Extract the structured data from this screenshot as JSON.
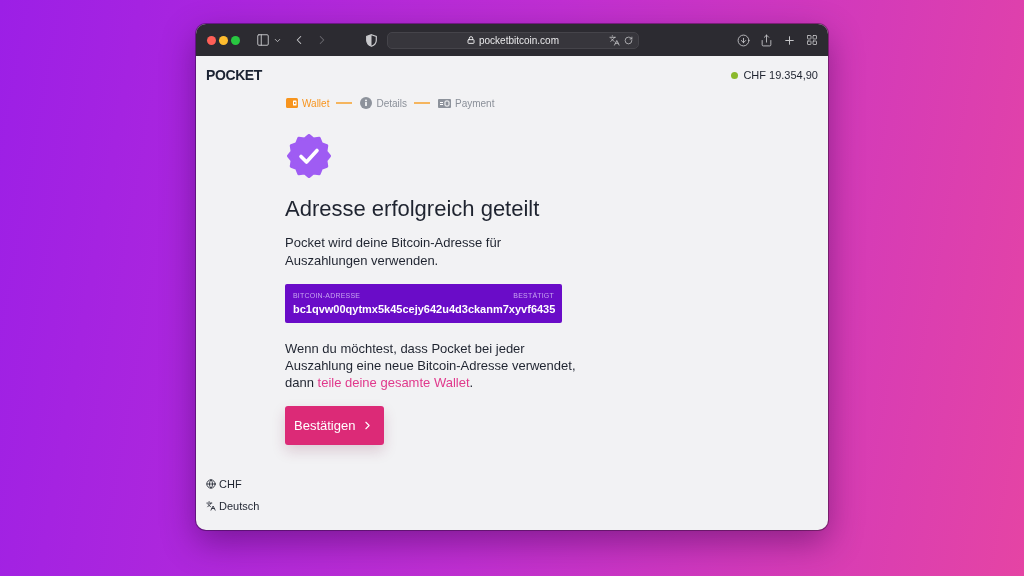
{
  "browser": {
    "url": "pocketbitcoin.com",
    "forward_disabled": true
  },
  "header": {
    "logo": "POCKET",
    "balance": "CHF 19.354,90"
  },
  "steps": [
    {
      "kind": "wallet",
      "label": "Wallet",
      "selected": true
    },
    {
      "kind": "info",
      "label": "Details",
      "selected": false
    },
    {
      "kind": "payment",
      "label": "Payment",
      "selected": false
    }
  ],
  "title": "Adresse erfolgreich geteilt",
  "intro": "Pocket wird deine Bitcoin-Adresse für Auszahlungen verwenden.",
  "address_card": {
    "label": "BITCOIN-ADRESSE",
    "status": "BESTÄTIGT",
    "value": "bc1qvw00qytmx5k45cejy642u4d3ckanm7xyvf6435"
  },
  "note": {
    "text": "Wenn du möchtest, dass Pocket bei jeder Auszahlung eine neue Bitcoin-Adresse verwendet, dann ",
    "link": "teile deine gesamte Wallet",
    "end": "."
  },
  "confirm_button": "Bestätigen",
  "footer": [
    {
      "kind": "currency",
      "label": "CHF"
    },
    {
      "kind": "language",
      "label": "Deutsch"
    }
  ]
}
